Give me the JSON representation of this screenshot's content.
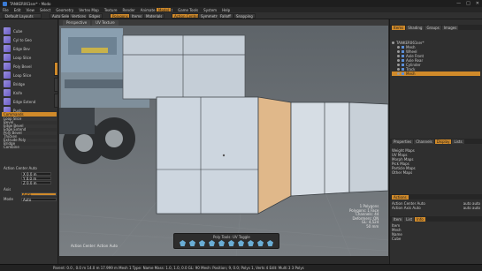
{
  "window": {
    "title": "TANKER061ser* - Modo",
    "controls": [
      "—",
      "□",
      "✕"
    ]
  },
  "menubar": [
    "File",
    "Edit",
    "View",
    "Select",
    "Geometry",
    "Vertex Map",
    "Texture",
    "Render",
    "Animate",
    "Layout",
    "Game Tools",
    "System",
    "Help"
  ],
  "toolbar": {
    "layout_select": "Default Layouts",
    "buttons": [
      "Auto Select",
      "Vertices",
      "Edges",
      "Polygons",
      "Items",
      "Materials",
      "Pivot",
      "Center",
      "Action Center",
      "Symmetry",
      "Falloff",
      "Snapping"
    ],
    "layout_tabs": [
      "Model",
      "Topology",
      "UV",
      "Paint",
      "Layout",
      "Setup",
      "Game Tools",
      "Animate",
      "Render",
      "Scripting",
      "Default Layouts"
    ]
  },
  "left_panel": {
    "tools": [
      "Cube",
      "Cyl to Geo",
      "Edge Bev",
      "Loop Slice",
      "Poly Bevel",
      "Loop Slice",
      "Bridge",
      "Knife",
      "Edge Extend",
      "Push",
      "Element Move",
      "Poly Bevel"
    ],
    "commands_header": "Commands",
    "commands": [
      "Loop Slice",
      "Bevel",
      "Edge Bevel",
      "Edge Extend",
      "Poly Bevel",
      "Thicken",
      "Extrude Poly",
      "Bridge",
      "Combine",
      "Merge",
      "Weld"
    ],
    "action_center_label": "Action Center Auto",
    "fields": [
      "X 0.0 m",
      "Y 0.0 m",
      "Z 0.0 m"
    ],
    "axis_label": "Axis",
    "axis_value": "Auto",
    "mode_label": "Mode",
    "mode_value": "Auto"
  },
  "viewport": {
    "tabs": [
      "Perspective",
      "UV Texture",
      "Graph",
      "Preview"
    ],
    "action_center_readout": "Action Center: Action Auto",
    "stats": [
      "1 Polygons",
      "Polygons: 1 Face",
      "Channels: 44",
      "Deformers: ON",
      "GL: 4,524",
      "50 mm"
    ],
    "pie_label": "Poly Tools: UV Toggle",
    "pie_icons": [
      "bevel-icon",
      "extrude-icon",
      "bridge-icon",
      "slice-icon",
      "knife-icon",
      "weld-icon",
      "merge-icon",
      "thicken-icon",
      "push-icon",
      "smooth-icon"
    ]
  },
  "right_panel": {
    "top_tabs": [
      "Items",
      "Shading",
      "Groups",
      "Images"
    ],
    "items": [
      "TANKER061ser*",
      "Mesh",
      "Wheel",
      "Axle Front",
      "Axle Rear",
      "Cylinder",
      "Track",
      "Body",
      "Mesh"
    ],
    "mid_tabs": [
      "Properties",
      "Channels",
      "Display",
      "Lists"
    ],
    "vertex_maps": [
      "Weight Maps",
      "UV Maps",
      "Morph Maps",
      "Pick Maps",
      "Particle Maps",
      "Other Maps"
    ],
    "action_header": "Actions",
    "action_rows": [
      {
        "name": "Action Center Auto",
        "value": "auto auto"
      },
      {
        "name": "Action Axis Auto",
        "value": "auto auto"
      }
    ],
    "bottom_tabs": [
      "Item",
      "List",
      "Info"
    ],
    "bottom_rows": [
      "Item",
      "Mesh",
      "Name",
      "Cube",
      "Group"
    ]
  },
  "statusbar": {
    "text": "Parent: 0.0 , 0.0 m  14.0 m 17.999 m  Mesh 1 Type: Name  Mass: 1.0, 1.0, 0.0  GL: 90  Mesh: Position; 9, 0.0; Polys 1, Verts 4  Edit: Multi 3 3 Polys"
  },
  "colors": {
    "accent": "#d08a2a",
    "viewport_bg": "#6a6f73",
    "mesh_face": "#c8d2dc",
    "mesh_face_selected": "#e0b88a"
  }
}
